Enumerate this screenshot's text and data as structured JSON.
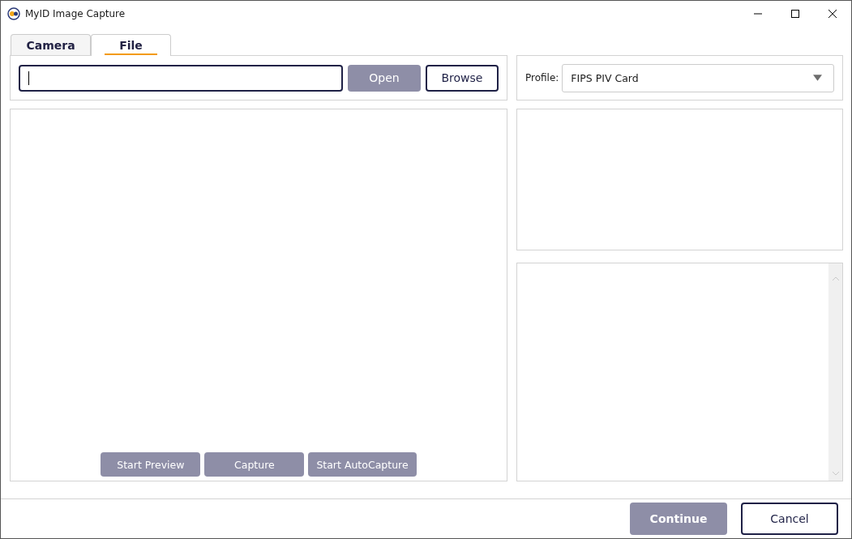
{
  "window": {
    "title": "MyID Image Capture"
  },
  "tabs": [
    {
      "label": "Camera",
      "selected": false
    },
    {
      "label": "File",
      "selected": true
    }
  ],
  "file": {
    "buttons": [
      {
        "label": "Open",
        "disabled": true
      },
      {
        "label": "Browse",
        "disabled": false
      }
    ]
  },
  "capture_buttons": [
    {
      "label": "Start Preview",
      "disabled": true
    },
    {
      "label": "Capture",
      "disabled": true
    },
    {
      "label": "Start AutoCapture",
      "disabled": true
    }
  ],
  "profile": {
    "label": "Profile:",
    "value": "FIPS PIV Card"
  },
  "footer_buttons": [
    {
      "label": "Continue",
      "disabled": true
    },
    {
      "label": "Cancel",
      "disabled": false
    }
  ]
}
